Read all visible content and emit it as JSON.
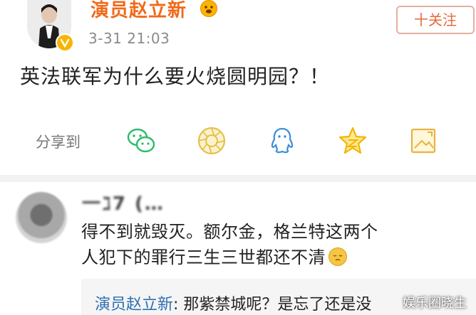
{
  "post": {
    "username": "演员赵立新",
    "time": "3-31 21:03",
    "follow_label": "十关注",
    "text": "英法联军为什么要火烧圆明园？！"
  },
  "share": {
    "label": "分享到",
    "icons": [
      "wechat-icon",
      "moments-icon",
      "qq-icon",
      "qzone-icon",
      "share-image-icon"
    ]
  },
  "comment": {
    "username": "一ℷ7 (…  ",
    "text": "得不到就毁灭。额尔金，格兰特这两个人犯下的罪行三生三世都还不清",
    "reply_name": "演员赵立新",
    "reply_text": ": 那紫禁城呢？是忘了还是没",
    "watermark": "娱乐圈晓生"
  },
  "colors": {
    "accent": "#f06a1a",
    "link": "#2f6fb0",
    "icon_green": "#2dbb6b",
    "icon_yellow": "#f2b500"
  }
}
